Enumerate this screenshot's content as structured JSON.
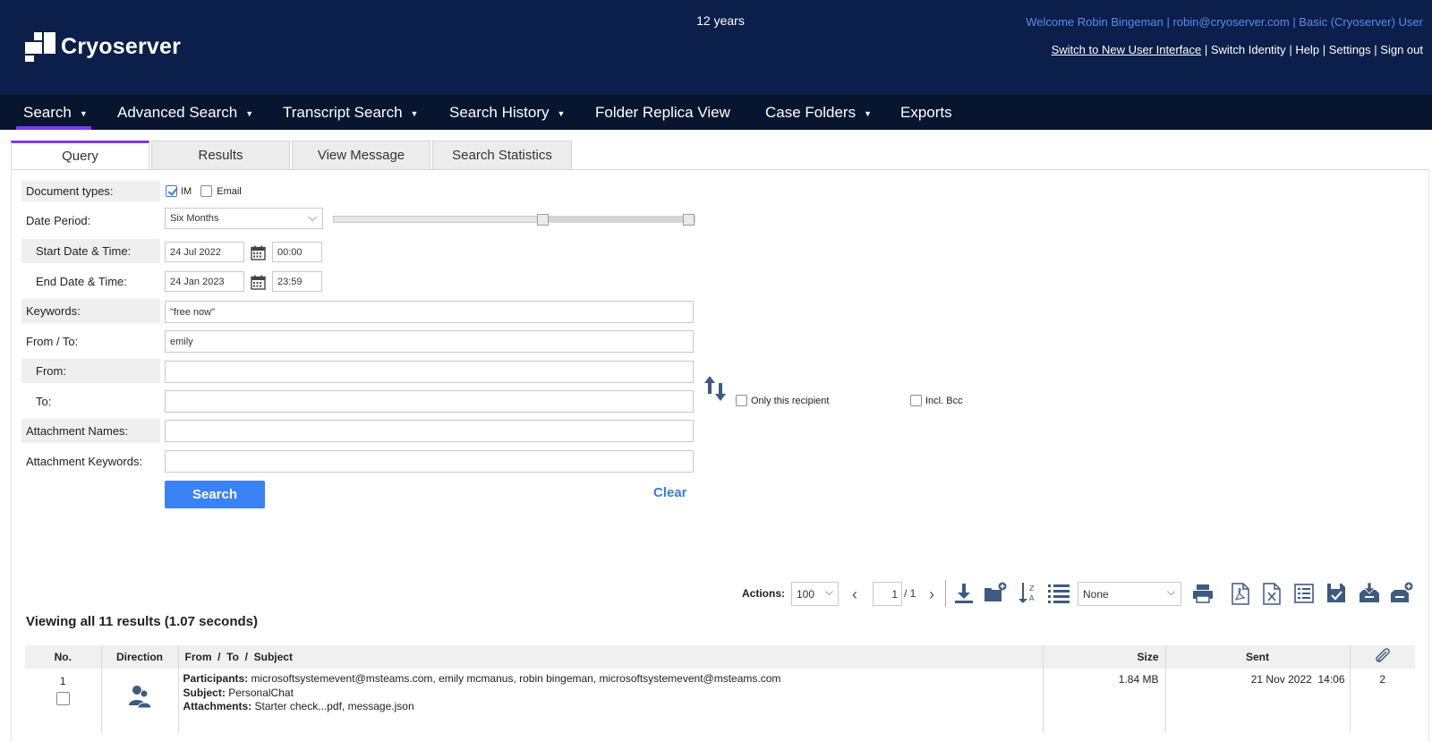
{
  "brand": {
    "name": "Cryoserver"
  },
  "header": {
    "retention": "12 years",
    "welcome": "Welcome Robin Bingeman | robin@cryoserver.com | Basic (Cryoserver) User",
    "links": [
      "Switch to New User Interface",
      "Switch Identity",
      "Help",
      "Settings",
      "Sign out"
    ]
  },
  "nav": [
    {
      "label": "Search",
      "caret": true,
      "active": true
    },
    {
      "label": "Advanced Search",
      "caret": true
    },
    {
      "label": "Transcript Search",
      "caret": true
    },
    {
      "label": "Search History",
      "caret": true
    },
    {
      "label": "Folder Replica View",
      "caret": false
    },
    {
      "label": "Case Folders",
      "caret": true
    },
    {
      "label": "Exports",
      "caret": false
    }
  ],
  "tabs": [
    "Query",
    "Results",
    "View Message",
    "Search Statistics"
  ],
  "active_tab": "Query",
  "form": {
    "doc_types_label": "Document types:",
    "doc_types": [
      {
        "label": "IM",
        "checked": true
      },
      {
        "label": "Email",
        "checked": false
      }
    ],
    "date_period_label": "Date Period:",
    "date_period_value": "Six Months",
    "start_label": "Start Date & Time:",
    "start_date": "24 Jul 2022",
    "start_time": "00:00",
    "end_label": "End Date & Time:",
    "end_date": "24 Jan 2023",
    "end_time": "23:59",
    "keywords_label": "Keywords:",
    "keywords_value": "\"free now\"",
    "from_to_label": "From / To:",
    "from_to_value": "emily",
    "from_label": "From:",
    "from_value": "",
    "to_label": "To:",
    "to_value": "",
    "only_recipient_label": "Only this recipient",
    "only_recipient_checked": false,
    "incl_bcc_label": "Incl. Bcc",
    "incl_bcc_checked": false,
    "attach_names_label": "Attachment Names:",
    "attach_names_value": "",
    "attach_keywords_label": "Attachment Keywords:",
    "attach_keywords_value": "",
    "search_button": "Search",
    "clear_button": "Clear"
  },
  "actions": {
    "label": "Actions:",
    "page_size": "100",
    "page_current": "1",
    "page_total": "/ 1",
    "sort_select": "None",
    "icons": [
      "download-icon",
      "add-folder-icon",
      "sort-icon",
      "list-icon",
      "print-icon",
      "pdf-icon",
      "excel-icon",
      "columns-icon",
      "save-search-icon",
      "inbox-download-icon",
      "inbox-add-icon"
    ]
  },
  "results": {
    "summary": "Viewing all 11 results (1.07 seconds)",
    "columns": [
      "No.",
      "Direction",
      "From  /  To  /  Subject",
      "Size",
      "Sent"
    ],
    "rows": [
      {
        "no": "1",
        "participants_label": "Participants:",
        "participants": "microsoftsystemevent@msteams.com, emily mcmanus, robin bingeman, microsoftsystemevent@msteams.com",
        "subject_label": "Subject:",
        "subject": "PersonalChat",
        "attachments_label": "Attachments:",
        "attachments": "Starter check...pdf, message.json",
        "size": "1.84 MB",
        "sent": "21 Nov 2022  14:06",
        "attachment_count": "2"
      }
    ]
  },
  "colors": {
    "header_bg": "#0b1f4a",
    "nav_bg": "#07152f",
    "accent": "#7c3aed",
    "button": "#3b82f6",
    "link": "#5b8cf0"
  }
}
